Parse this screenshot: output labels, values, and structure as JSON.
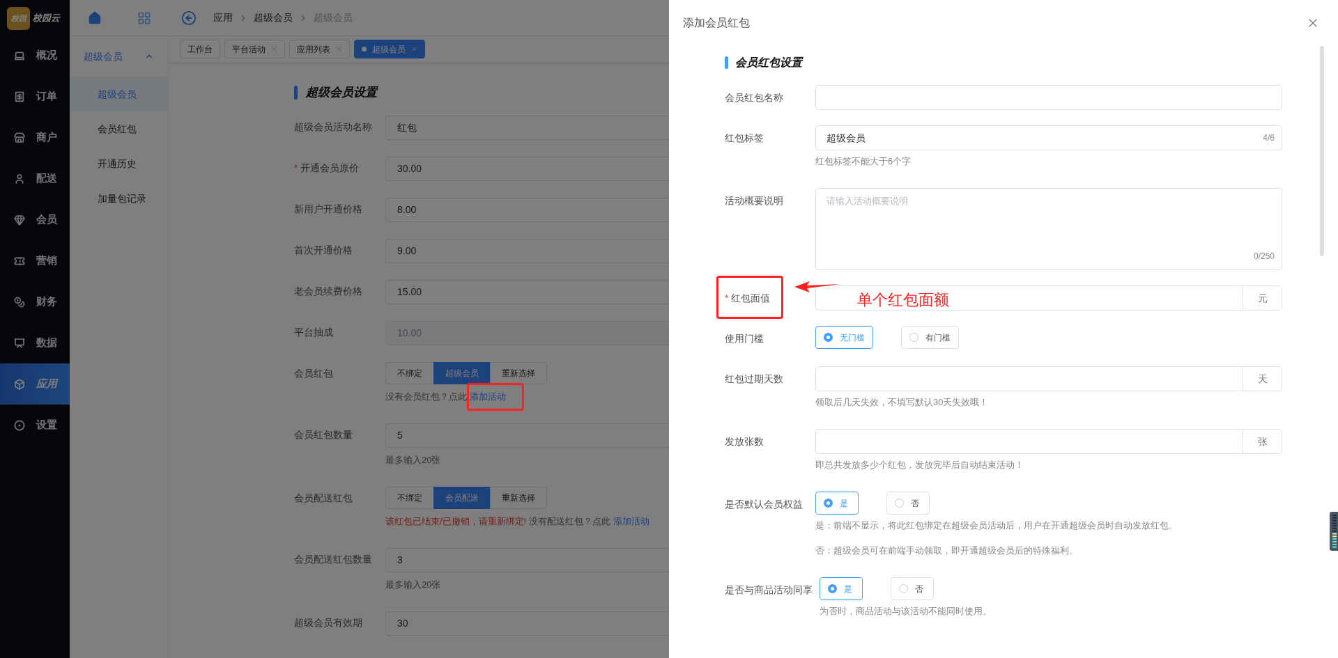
{
  "app": {
    "logo_mark": "校园",
    "name": "校园云"
  },
  "nav": [
    {
      "label": "概况",
      "selected": false
    },
    {
      "label": "订单",
      "selected": false
    },
    {
      "label": "商户",
      "selected": false
    },
    {
      "label": "配送",
      "selected": false
    },
    {
      "label": "会员",
      "selected": false
    },
    {
      "label": "营销",
      "selected": false
    },
    {
      "label": "财务",
      "selected": false
    },
    {
      "label": "数据",
      "selected": false
    },
    {
      "label": "应用",
      "selected": true
    },
    {
      "label": "设置",
      "selected": false
    }
  ],
  "breadcrumb": [
    "应用",
    "超级会员",
    "超级会员"
  ],
  "tabs": [
    {
      "label": "工作台",
      "selected": false,
      "closable": false
    },
    {
      "label": "平台活动",
      "selected": false,
      "closable": true
    },
    {
      "label": "应用列表",
      "selected": false,
      "closable": true
    },
    {
      "label": "超级会员",
      "selected": true,
      "closable": true
    }
  ],
  "submenu": {
    "title": "超级会员",
    "expanded": true,
    "items": [
      {
        "label": "超级会员",
        "selected": true
      },
      {
        "label": "会员红包",
        "selected": false
      },
      {
        "label": "开通历史",
        "selected": false
      },
      {
        "label": "加量包记录",
        "selected": false
      }
    ]
  },
  "form": {
    "title": "超级会员设置",
    "rows": [
      {
        "kind": "input",
        "label": "超级会员活动名称",
        "value": "红包",
        "disabled": false
      },
      {
        "kind": "input",
        "label": "开通会员原价",
        "required_mark": "*",
        "value": "30.00",
        "disabled": false
      },
      {
        "kind": "input",
        "label": "新用户开通价格",
        "value": "8.00",
        "disabled": false
      },
      {
        "kind": "input",
        "label": "首次开通价格",
        "value": "9.00",
        "disabled": false
      },
      {
        "kind": "input",
        "label": "老会员续费价格",
        "value": "15.00",
        "disabled": false
      },
      {
        "kind": "input",
        "label": "平台抽成",
        "value": "10.00",
        "disabled": true
      },
      {
        "kind": "segmented",
        "label": "会员红包",
        "options": [
          {
            "label": "不绑定",
            "selected": false
          },
          {
            "label": "超级会员",
            "selected": true
          },
          {
            "label": "重新选择",
            "selected": false
          }
        ],
        "hint": "没有会员红包？点此",
        "link": "添加活动",
        "annotated": true
      },
      {
        "kind": "input",
        "label": "会员红包数量",
        "value": "5",
        "disabled": false,
        "hint": "最多输入20张"
      },
      {
        "kind": "segmented",
        "label": "会员配送红包",
        "options": [
          {
            "label": "不绑定",
            "selected": false
          },
          {
            "label": "会员配送",
            "selected": true
          },
          {
            "label": "重新选择",
            "selected": false
          }
        ],
        "error": "该红包已结束/已撤销，请重新绑定!",
        "hint": "没有配送红包？点此",
        "link": "添加活动",
        "annotated": false
      },
      {
        "kind": "input",
        "label": "会员配送红包数量",
        "value": "3",
        "disabled": false,
        "hint": "最多输入20张"
      },
      {
        "kind": "input",
        "label": "超级会员有效期",
        "value": "30",
        "disabled": false
      }
    ]
  },
  "drawer": {
    "title": "添加会员红包",
    "section": "会员红包设置",
    "fields": [
      {
        "kind": "input",
        "label": "会员红包名称"
      },
      {
        "kind": "input",
        "label": "红包标签",
        "value": "超级会员",
        "counter": "4/6",
        "hints": [
          "红包标签不能大于6个字"
        ]
      },
      {
        "kind": "textarea",
        "label": "活动概要说明",
        "placeholder": "请输入活动概要说明",
        "counter": "0/250"
      },
      {
        "kind": "input",
        "label": "红包面值",
        "required_mark": "*",
        "suffix": "元",
        "annotated": true,
        "note": "单个红包面额"
      },
      {
        "kind": "radio",
        "label": "使用门槛",
        "options": [
          {
            "label": "无门槛",
            "selected": true
          },
          {
            "label": "有门槛",
            "selected": false
          }
        ]
      },
      {
        "kind": "input",
        "label": "红包过期天数",
        "suffix": "天",
        "hints": [
          "领取后几天失效，不填写默认30天失效哦！"
        ]
      },
      {
        "kind": "input",
        "label": "发放张数",
        "suffix": "张",
        "hints": [
          "即总共发放多少个红包，发放完毕后自动结束活动！"
        ]
      },
      {
        "kind": "radio",
        "label": "是否默认会员权益",
        "options": [
          {
            "label": "是",
            "selected": true
          },
          {
            "label": "否",
            "selected": false
          }
        ],
        "hints": [
          "是：前端不显示，将此红包绑定在超级会员活动后，用户在开通超级会员时自动发放红包。",
          "否：超级会员可在前端手动领取，即开通超级会员后的特殊福利。"
        ]
      },
      {
        "kind": "radio",
        "label": "是否与商品活动同享",
        "options": [
          {
            "label": "是",
            "selected": true
          },
          {
            "label": "否",
            "selected": false
          }
        ],
        "hints": [
          "为否时，商品活动与该活动不能同时使用。"
        ]
      }
    ]
  }
}
